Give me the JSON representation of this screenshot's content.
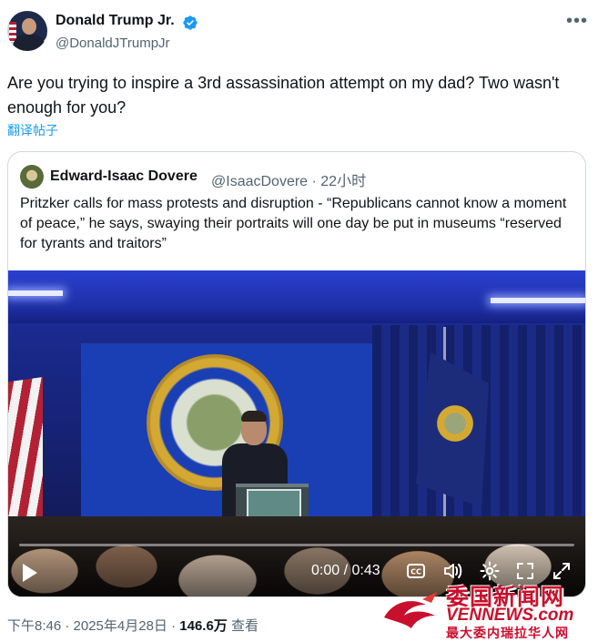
{
  "author": {
    "name": "Donald Trump Jr.",
    "handle": "@DonaldJTrumpJr",
    "verified_color": "#1d9bf0"
  },
  "tweet": {
    "text": "Are you trying to inspire a 3rd assassination attempt on my dad? Two wasn't enough for you?",
    "translate_label": "翻译帖子"
  },
  "quote": {
    "name": "Edward-Isaac Dovere",
    "handle_time": "@IsaacDovere · 22小时",
    "text": "Pritzker calls for mass protests and disruption - “Republicans cannot know a moment of peace,” he says, swaying their portraits will one day be put in museums “reserved for tyrants and traitors”",
    "video": {
      "time": "0:00 / 0:43",
      "icons": [
        "play-icon",
        "captions-icon",
        "volume-icon",
        "settings-icon",
        "expand-icon"
      ],
      "progress": 0
    }
  },
  "footer": {
    "timestamp": "下午8:46 · 2025年4月28日 · ",
    "views": "146.6万",
    "views_label": " 查看"
  },
  "watermark": {
    "title": "委国新闻网",
    "url": "VENNEWS.com",
    "subtitle": "最大委内瑞拉华人网",
    "color": "#c8102e"
  }
}
